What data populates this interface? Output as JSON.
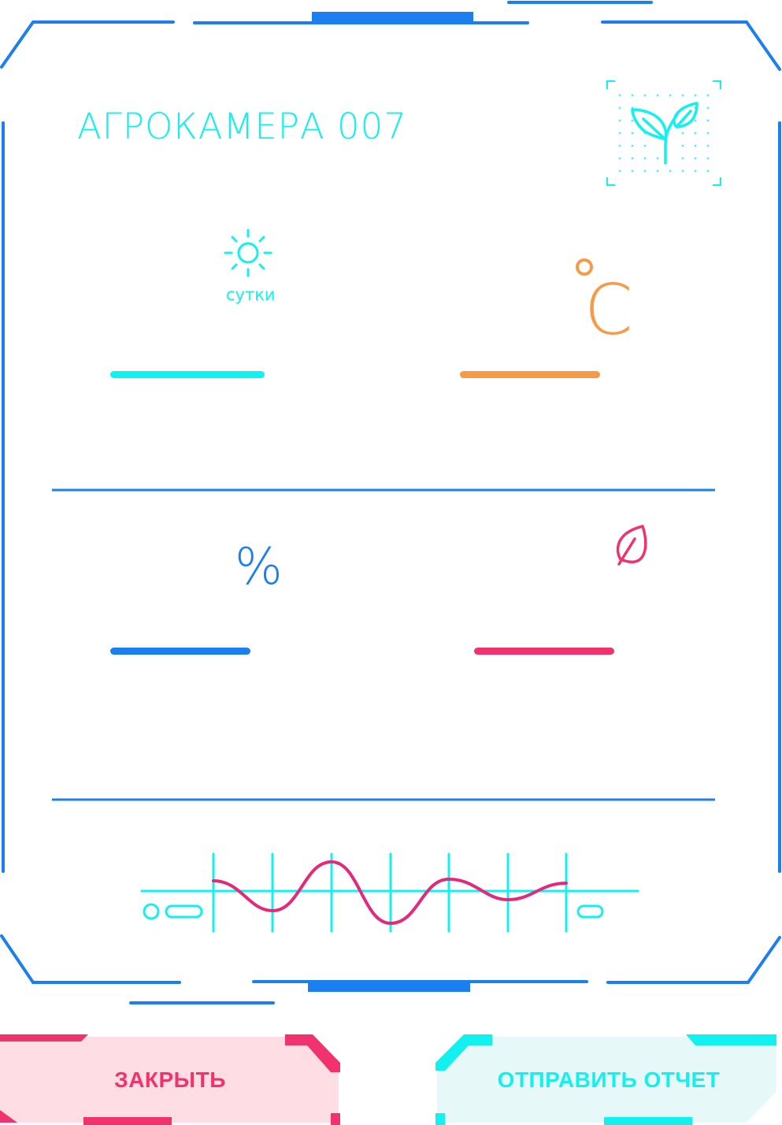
{
  "header": {
    "title": "АГРОКАМЕРА 007",
    "plant_icon": "sprout-icon"
  },
  "metrics": {
    "days": {
      "icon": "sun-icon",
      "unit": "сутки",
      "color": "#12f0f0"
    },
    "temperature": {
      "icon": "degree-icon",
      "unit": "C",
      "color": "#f79a48"
    },
    "humidity": {
      "unit": "%",
      "color": "#1b7ff0"
    },
    "growth": {
      "icon": "leaf-icon",
      "color": "#f0336e"
    }
  },
  "chart_icon": "wave-chart-icon",
  "buttons": {
    "close_label": "ЗАКРЫТЬ",
    "send_report_label": "ОТПРАВИТЬ ОТЧЕТ"
  },
  "colors": {
    "frame_blue": "#1b7ff0",
    "accent_cyan": "#12f0f0",
    "accent_pink": "#f0336e",
    "accent_orange": "#f79a48"
  }
}
